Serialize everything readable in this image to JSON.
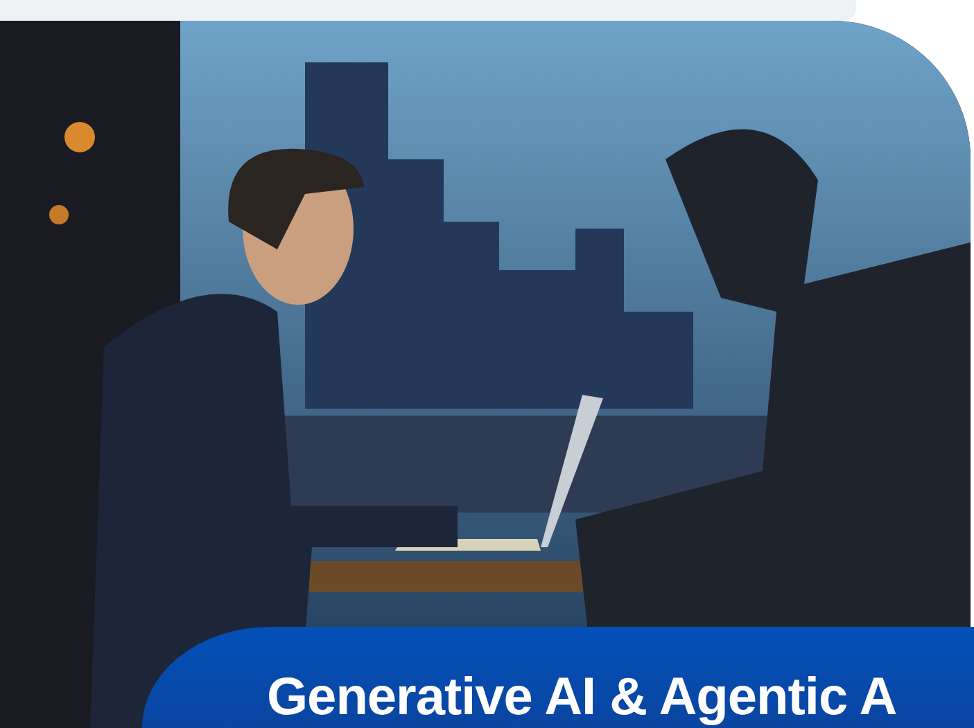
{
  "banner": {
    "title": "Generative AI & Agentic A"
  }
}
